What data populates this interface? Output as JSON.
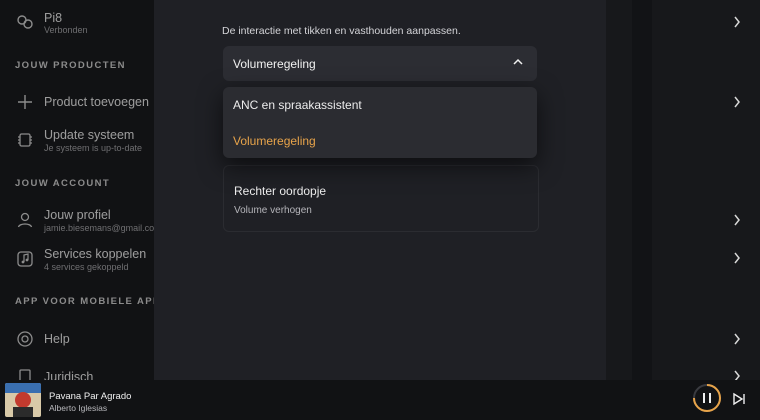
{
  "sidebar": {
    "device": {
      "name": "Pi8",
      "status": "Verbonden",
      "icon": "earbuds-icon"
    },
    "section_products": "JOUW PRODUCTEN",
    "add_product": {
      "label": "Product toevoegen",
      "icon": "plus-icon"
    },
    "update": {
      "label": "Update systeem",
      "sub": "Je systeem is up-to-date",
      "icon": "chip-icon"
    },
    "section_account": "JOUW ACCOUNT",
    "profile": {
      "label": "Jouw profiel",
      "sub": "jamie.biesemans@gmail.co",
      "icon": "user-icon"
    },
    "services": {
      "label": "Services koppelen",
      "sub": "4 services gekoppeld",
      "icon": "music-note-icon"
    },
    "section_app": "APP VOOR MOBIELE APPAR",
    "help": {
      "label": "Help",
      "icon": "lifebuoy-icon"
    },
    "legal": {
      "label": "Juridisch",
      "icon": "document-icon"
    }
  },
  "main": {
    "description": "De interactie met tikken en vasthouden aanpassen.",
    "select": {
      "value": "Volumeregeling",
      "icon": "chevron-up-icon"
    },
    "dropdown": {
      "options": [
        "ANC en spraakassistent",
        "Volumeregeling"
      ],
      "selected_index": 1,
      "selected_color": "#e8a44a"
    },
    "card": {
      "title": "Rechter oordopje",
      "subtitle": "Volume verhogen"
    }
  },
  "player": {
    "track": "Pavana Par Agrado",
    "artist": "Alberto Iglesias",
    "accent": "#e8a44a"
  }
}
